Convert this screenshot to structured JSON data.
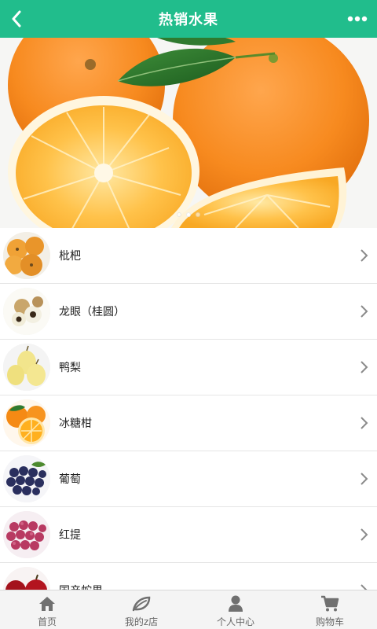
{
  "header": {
    "title": "热销水果",
    "back_icon": "back-chevron-icon",
    "more_icon": "more-dots-icon",
    "color": "#21bd8c"
  },
  "banner": {
    "slide_count": 3,
    "active_index": 1
  },
  "products": [
    {
      "name": "枇杷",
      "icon": "loquat"
    },
    {
      "name": "龙眼（桂圆）",
      "icon": "longan"
    },
    {
      "name": "鸭梨",
      "icon": "pear"
    },
    {
      "name": "冰糖柑",
      "icon": "orange"
    },
    {
      "name": "葡萄",
      "icon": "grape"
    },
    {
      "name": "红提",
      "icon": "red-grape"
    },
    {
      "name": "国产蛇果",
      "icon": "apple"
    }
  ],
  "tabbar": {
    "tabs": [
      {
        "label": "首页",
        "icon": "home-icon"
      },
      {
        "label": "我的z店",
        "icon": "leaf-icon"
      },
      {
        "label": "个人中心",
        "icon": "person-icon"
      },
      {
        "label": "购物车",
        "icon": "cart-icon"
      }
    ]
  }
}
